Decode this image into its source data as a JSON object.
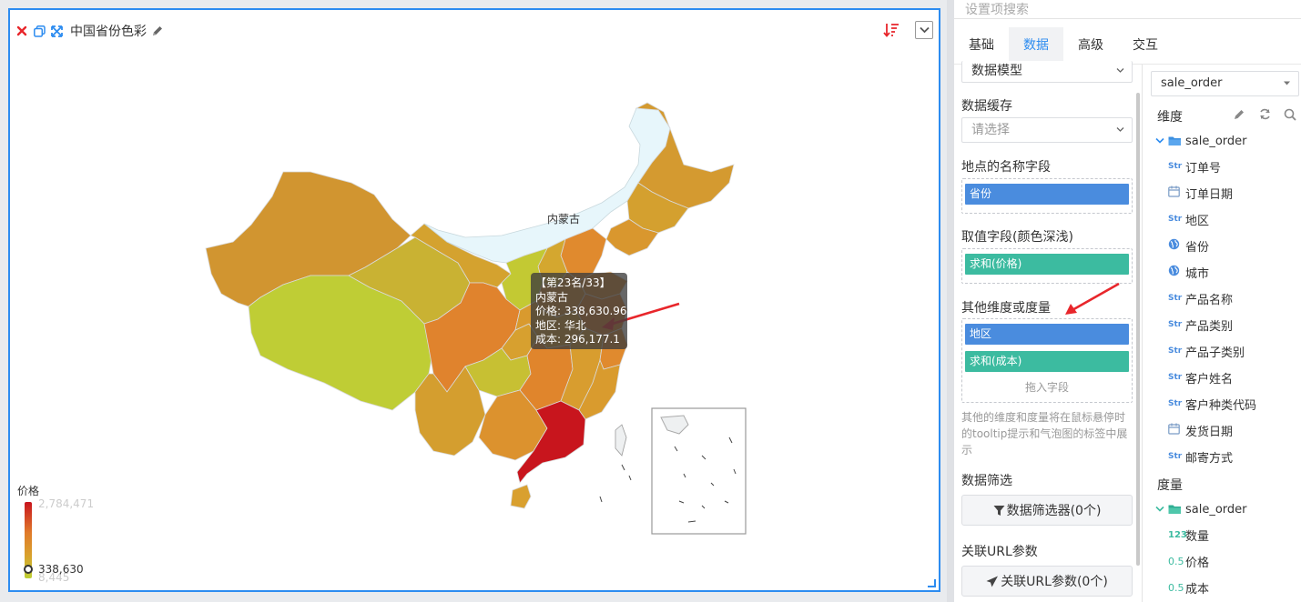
{
  "widget": {
    "title": "中国省份色彩",
    "region_label": "内蒙古",
    "tooltip": {
      "rank": "【第23名/33】",
      "name": "内蒙古",
      "price": "价格: 338,630.96",
      "region": "地区: 华北",
      "cost": "成本: 296,177.1"
    },
    "legend": {
      "title": "价格",
      "max": "2,784,471",
      "current": "338,630",
      "min": "8,445"
    }
  },
  "panel": {
    "search_placeholder": "设置项搜索",
    "tabs": [
      "基础",
      "数据",
      "高级",
      "交互"
    ],
    "active_tab": "数据",
    "left": {
      "model_select": "数据模型",
      "cache_label": "数据缓存",
      "cache_placeholder": "请选择",
      "name_field_label": "地点的名称字段",
      "name_field_chip": "省份",
      "value_field_label": "取值字段(颜色深浅)",
      "value_field_chip": "求和(价格)",
      "other_label": "其他维度或度量",
      "other_chips": [
        "地区",
        "求和(成本)"
      ],
      "drop_hint": "拖入字段",
      "other_desc": "其他的维度和度量将在鼠标悬停时的tooltip提示和气泡图的标签中展示",
      "filter_label": "数据筛选",
      "filter_button": "数据筛选器(0个)",
      "url_label": "关联URL参数",
      "url_button": "关联URL参数(0个)"
    },
    "right": {
      "dataset_select": "sale_order",
      "dims_title": "维度",
      "dims_folder": "sale_order",
      "dims": [
        {
          "type": "Str",
          "name": "订单号"
        },
        {
          "type": "date",
          "name": "订单日期"
        },
        {
          "type": "Str",
          "name": "地区"
        },
        {
          "type": "geo",
          "name": "省份"
        },
        {
          "type": "geo",
          "name": "城市"
        },
        {
          "type": "Str",
          "name": "产品名称"
        },
        {
          "type": "Str",
          "name": "产品类别"
        },
        {
          "type": "Str",
          "name": "产品子类别"
        },
        {
          "type": "Str",
          "name": "客户姓名"
        },
        {
          "type": "Str",
          "name": "客户种类代码"
        },
        {
          "type": "date",
          "name": "发货日期"
        },
        {
          "type": "Str",
          "name": "邮寄方式"
        }
      ],
      "measures_title": "度量",
      "measures_folder": "sale_order",
      "measures": [
        {
          "type": "123",
          "name": "数量"
        },
        {
          "type": "0.5",
          "name": "价格"
        },
        {
          "type": "0.5",
          "name": "成本"
        }
      ]
    }
  },
  "colors": {
    "accent": "#2d8cf0",
    "chip_blue": "#4a8cde",
    "chip_green": "#3cbba0",
    "map_high": "#c8141e",
    "map_low": "#bdcf33",
    "arrow": "#e8262b"
  }
}
